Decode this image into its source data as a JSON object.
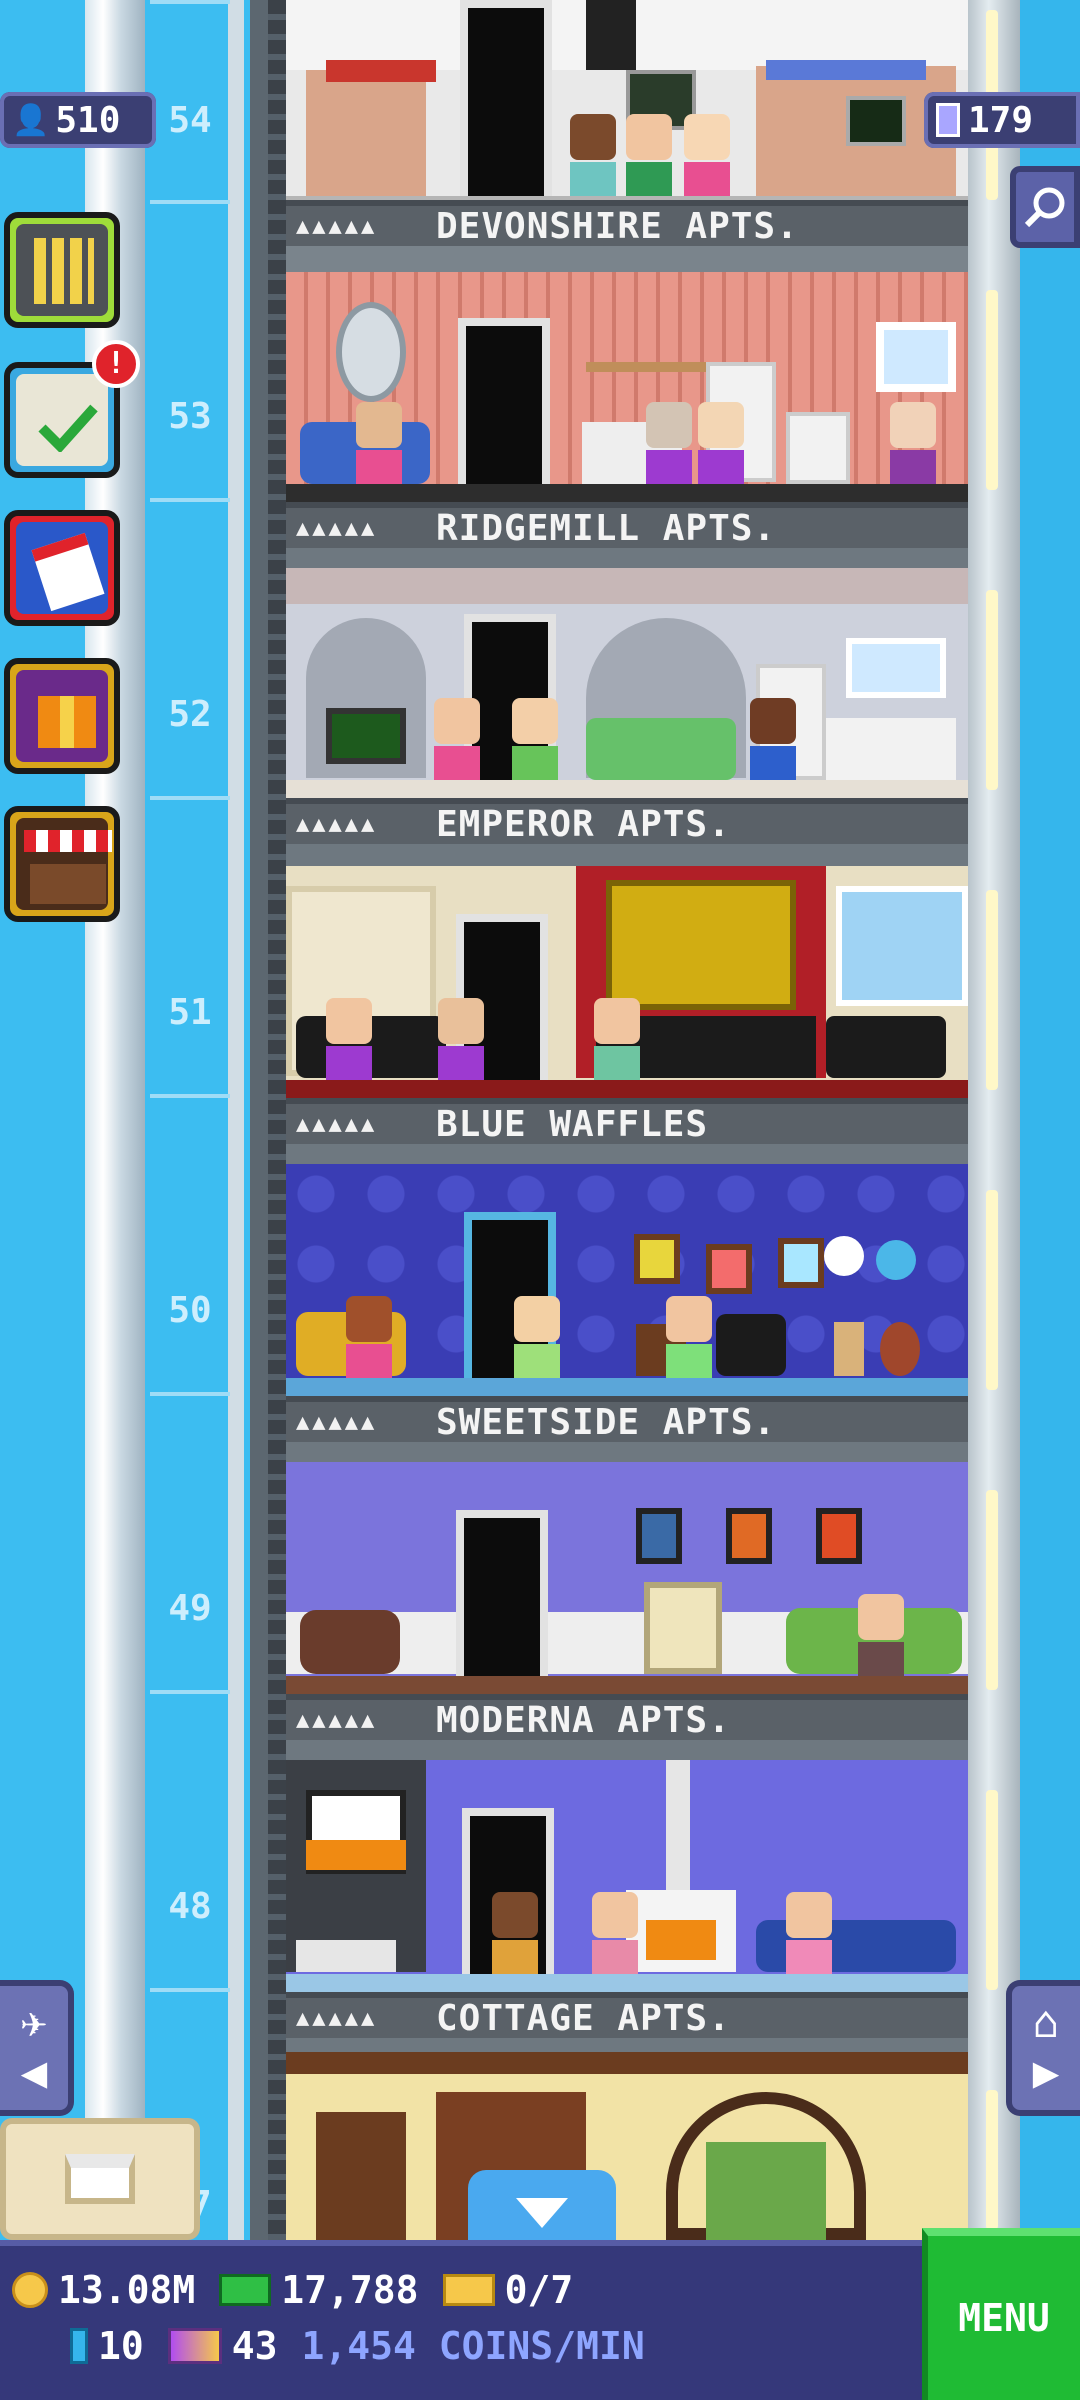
{
  "top_stats": {
    "population": "510",
    "floors_count": "179"
  },
  "shaft": {
    "floor_numbers": [
      "54",
      "53",
      "52",
      "51",
      "50",
      "49",
      "48",
      "47"
    ]
  },
  "floors": [
    {
      "number": "54",
      "name": "DEVONSHIRE APTS.",
      "stars": "▲▲▲▲▲"
    },
    {
      "number": "53",
      "name": "RIDGEMILL APTS.",
      "stars": "▲▲▲▲▲"
    },
    {
      "number": "52",
      "name": "EMPEROR APTS.",
      "stars": "▲▲▲▲▲"
    },
    {
      "number": "51",
      "name": "BLUE WAFFLES",
      "stars": "▲▲▲▲▲"
    },
    {
      "number": "50",
      "name": "SWEETSIDE APTS.",
      "stars": "▲▲▲▲▲"
    },
    {
      "number": "49",
      "name": "MODERNA APTS.",
      "stars": "▲▲▲▲▲"
    },
    {
      "number": "48",
      "name": "COTTAGE APTS.",
      "stars": "▲▲▲▲▲"
    }
  ],
  "side_buttons": {
    "missions_badge": "!"
  },
  "hud": {
    "coins": "13.08M",
    "tower_bux": "17,788",
    "tickets": "0/7",
    "blue_count": "10",
    "golden_count": "43",
    "coins_per_min": "1,454 COINS/MIN",
    "menu_label": "MENU"
  },
  "icons": {
    "population": "person-icon",
    "floors": "building-icon",
    "search": "magnifier-icon",
    "vip": "vip-person-icon",
    "home": "home-icon",
    "down": "chevron-down-icon",
    "box": "box-icon"
  },
  "colors": {
    "sky": "#35b6ec",
    "hud_bg": "#35387a",
    "menu_green": "#1fbb34",
    "rate_text": "#8ea5ff"
  }
}
